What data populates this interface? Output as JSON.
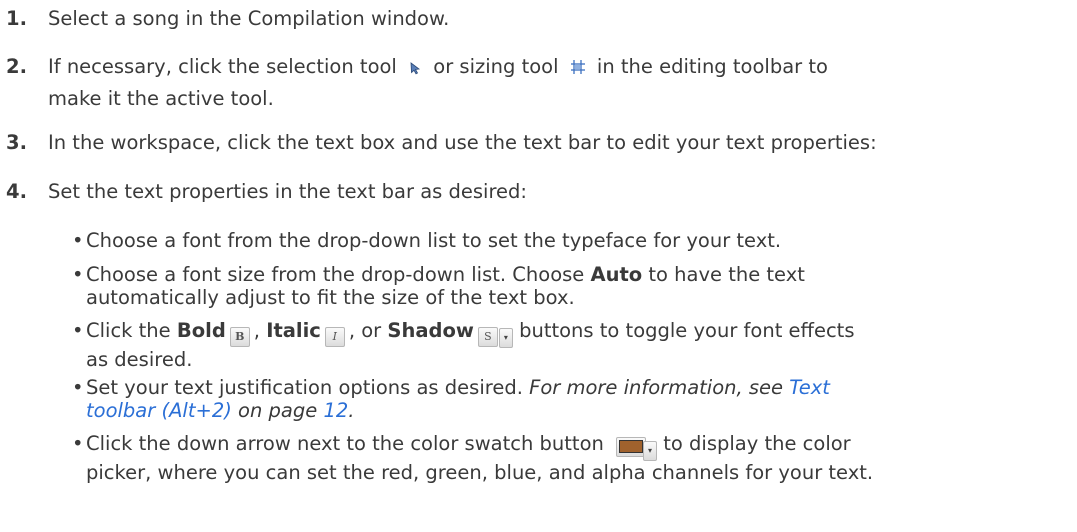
{
  "steps": [
    {
      "num": "1.",
      "text": "Select a song in the Compilation window."
    },
    {
      "num": "2.",
      "text_a": "If necessary, click the selection tool",
      "text_b": "or sizing tool",
      "text_c": "in the editing toolbar to",
      "text_d": "make it the active tool."
    },
    {
      "num": "3.",
      "text": "In the workspace, click the text box and use the text bar to edit your text properties:"
    },
    {
      "num": "4.",
      "text": "Set the text properties in the text bar as desired:"
    }
  ],
  "bullets": {
    "b1": "Choose a font from the drop-down list to set the typeface for your text.",
    "b2_a": "Choose a font size from the drop-down list. Choose",
    "b2_bold": "Auto",
    "b2_b": "to have the text",
    "b2_c": "automatically adjust to fit the size of the text box.",
    "b3_a": "Click the",
    "b3_bold": "Bold",
    "b3_sep1": ",",
    "b3_italic": "Italic",
    "b3_sep2": ", or",
    "b3_shadow": "Shadow",
    "b3_b": "buttons to toggle your font effects",
    "b3_c": "as desired.",
    "b4_a": "Set your text justification options as desired.",
    "b4_b": "For more information, see",
    "b4_link1": "Text",
    "b4_link2": "toolbar (Alt+2)",
    "b4_c": "on page",
    "b4_page": "12",
    "b4_end": ".",
    "b5_a": "Click the down arrow next to the color swatch button",
    "b5_b": "to display the color",
    "b5_c": "picker, where you can set the red, green, blue, and alpha channels for your text."
  },
  "glyphs": {
    "bold_btn": "B",
    "italic_btn": "I",
    "shadow_btn": "S",
    "drop_arrow": "▾",
    "bullet": "•"
  },
  "icons": [
    "selection-tool-icon",
    "sizing-tool-icon",
    "bold-button",
    "italic-button",
    "shadow-button",
    "color-swatch-button"
  ],
  "colors": {
    "text": "#3a3a3a",
    "link": "#2b6fd6",
    "swatch": "#a0622d"
  }
}
